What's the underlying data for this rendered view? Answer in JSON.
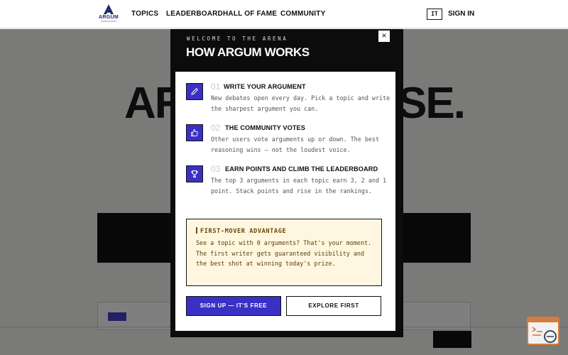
{
  "nav": {
    "logo_text": "ARGUM",
    "links": [
      "TOPICS",
      "LEADERBOARD",
      "HALL OF FAME",
      "COMMUNITY"
    ],
    "language": "IT",
    "sign_in": "SIGN IN"
  },
  "background": {
    "hero_left": "AR",
    "hero_right": "SE."
  },
  "modal": {
    "eyebrow": "WELCOME TO THE ARENA",
    "title": "HOW ARGUM WORKS",
    "close_label": "×",
    "steps": [
      {
        "number": "01",
        "title": "WRITE YOUR ARGUMENT",
        "description": "New debates open every day. Pick a topic and write the sharpest argument you can.",
        "icon": "pencil-icon"
      },
      {
        "number": "02",
        "title": "THE COMMUNITY VOTES",
        "description": "Other users vote arguments up or down. The best reasoning wins — not the loudest voice.",
        "icon": "thumbs-up-icon"
      },
      {
        "number": "03",
        "title": "EARN POINTS AND CLIMB THE LEADERBOARD",
        "description": "The top 3 arguments in each topic earn 3, 2 and 1 point. Stack points and rise in the rankings.",
        "icon": "trophy-icon"
      }
    ],
    "tip": {
      "title": "FIRST-MOVER ADVANTAGE",
      "description": "See a topic with 0 arguments? That's your moment. The first writer gets guaranteed visibility and the best shot at winning today's prize."
    },
    "primary_button": "SIGN UP — IT'S FREE",
    "secondary_button": "EXPLORE FIRST"
  },
  "colors": {
    "accent": "#3b30c4",
    "tip_background": "#fff6e0",
    "tip_text": "#6a4b09",
    "modal_dark": "#0c0c0c",
    "widget_orange": "#e07b39"
  }
}
